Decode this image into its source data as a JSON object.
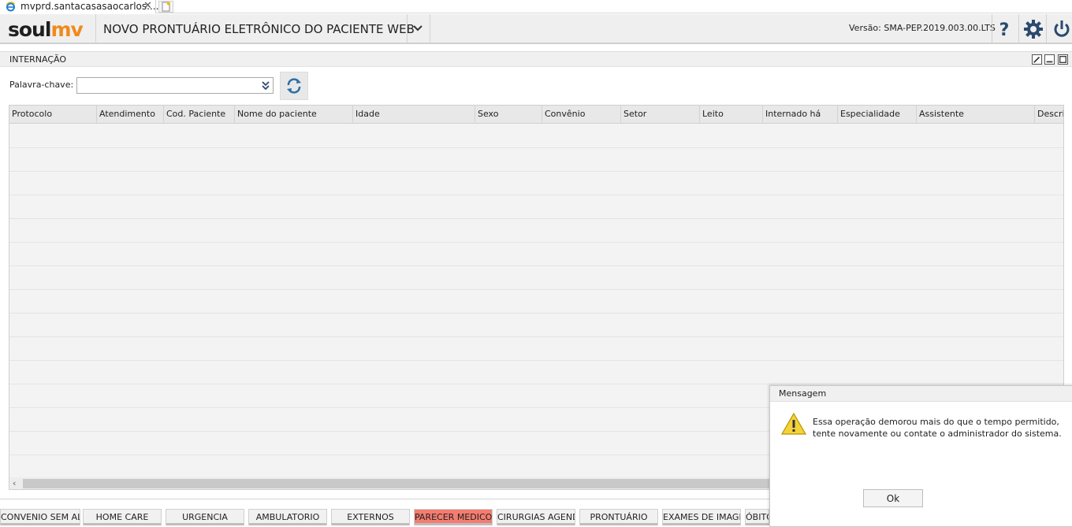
{
  "browser": {
    "tab_title": "mvprd.santacasasaocarlos....",
    "close_glyph": "✕"
  },
  "header": {
    "logo_soul": "soul",
    "logo_mv": "mv",
    "title": "NOVO PRONTUÁRIO ELETRÔNICO DO PACIENTE WEB",
    "version": "Versão: SMA-PEP.2019.003.00.LTS",
    "brand_color": "#f08a1c",
    "icons": [
      "chevron-down-icon",
      "help-icon",
      "gear-icon",
      "power-icon"
    ]
  },
  "panel": {
    "title": "INTERNAÇÃO",
    "keyword_label": "Palavra-chave:",
    "keyword_value": "",
    "icons": [
      "edit-icon",
      "minimize-icon",
      "maximize-icon",
      "refresh-icon"
    ]
  },
  "grid": {
    "columns": [
      "Protocolo",
      "Atendimento",
      "Cod. Paciente",
      "Nome do paciente",
      "Idade",
      "Sexo",
      "Convênio",
      "Setor",
      "Leito",
      "Internado há",
      "Especialidade",
      "Assistente",
      "Descriç"
    ],
    "rows": [],
    "scroll_left": "‹"
  },
  "bottom_tabs": [
    {
      "label": "CONVENIO SEM ALTA",
      "active": false
    },
    {
      "label": "HOME CARE",
      "active": false
    },
    {
      "label": "URGENCIA",
      "active": false
    },
    {
      "label": "AMBULATORIO",
      "active": false
    },
    {
      "label": "EXTERNOS",
      "active": false
    },
    {
      "label": "PARECER MEDICO",
      "active": true
    },
    {
      "label": "CIRURGIAS AGENDADAS",
      "active": false
    },
    {
      "label": "PRONTUÁRIO",
      "active": false
    },
    {
      "label": "EXAMES DE IMAGEM",
      "active": false
    },
    {
      "label": "ÓBITO",
      "active": false
    }
  ],
  "dialog": {
    "title": "Mensagem",
    "message": "Essa operação demorou mais do que o tempo permitido, tente novamente ou contate o administrador do sistema.",
    "ok_label": "Ok",
    "icon": "warning-icon"
  }
}
